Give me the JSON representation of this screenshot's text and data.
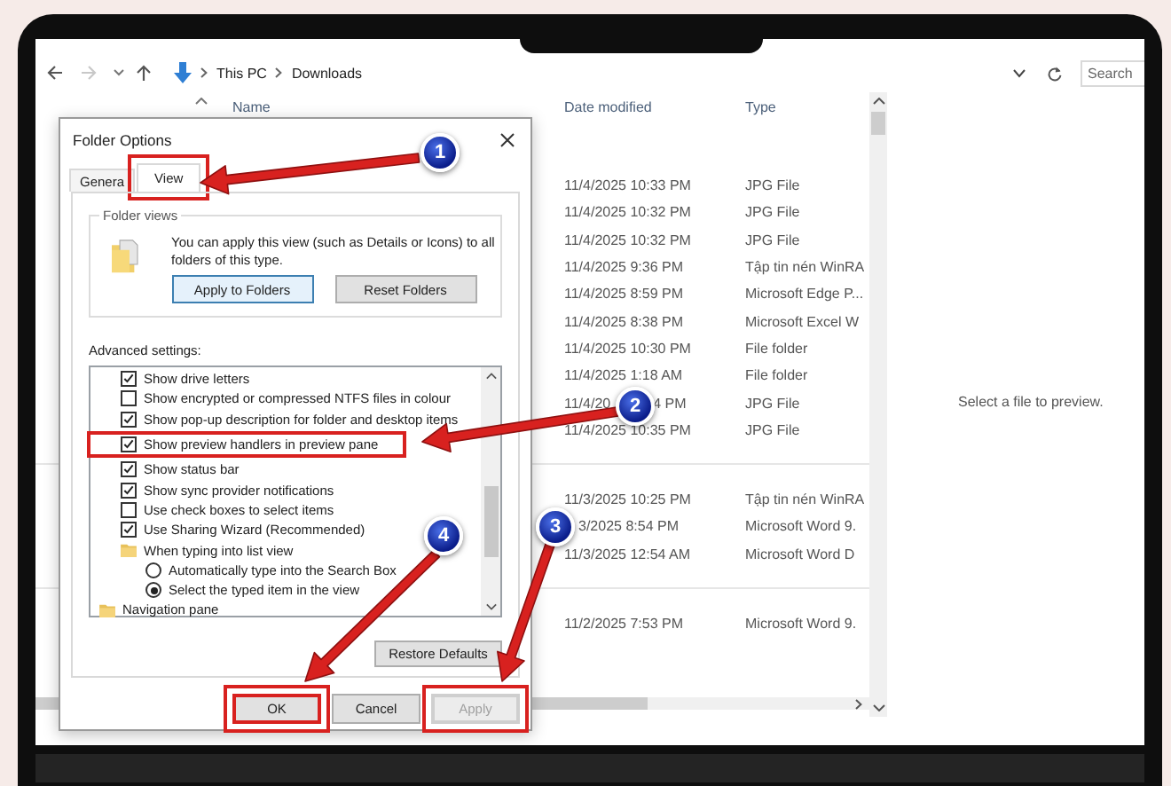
{
  "explorer": {
    "path": [
      "This PC",
      "Downloads"
    ],
    "search": {
      "placeholder": "Search"
    },
    "columns": [
      "Name",
      "Date modified",
      "Type"
    ],
    "groups": [
      {
        "rows": [
          {
            "date": "11/4/2025 10:33 PM",
            "type": "JPG File"
          },
          {
            "date": "11/4/2025 10:32 PM",
            "type": "JPG File"
          },
          {
            "date": "11/4/2025 10:32 PM",
            "type": "JPG File"
          },
          {
            "date": "11/4/2025 9:36 PM",
            "type": "Tập tin nén WinRA"
          },
          {
            "date": "11/4/2025 8:59 PM",
            "type": "Microsoft Edge P..."
          },
          {
            "date": "11/4/2025 8:38 PM",
            "type": "Microsoft Excel W"
          },
          {
            "date": "11/4/2025 10:30 PM",
            "type": "File folder"
          },
          {
            "date": "11/4/2025 1:18 AM",
            "type": "File folder"
          },
          {
            "date": "11/4/20",
            "date_end": "4 PM",
            "type": "JPG File"
          },
          {
            "date": "11/4/2025 10:35 PM",
            "type": "JPG File"
          }
        ]
      },
      {
        "rows": [
          {
            "date": "11/3/2025 10:25 PM",
            "type": "Tập tin nén WinRA"
          },
          {
            "date_end": "3/2025 8:54 PM",
            "type": "Microsoft Word 9."
          },
          {
            "date": "11/3/2025 12:54 AM",
            "type": "Microsoft Word D"
          }
        ]
      },
      {
        "rows": [
          {
            "date": "11/2/2025 7:53 PM",
            "type": "Microsoft Word 9."
          }
        ]
      }
    ],
    "preview_message": "Select a file to preview."
  },
  "dialog": {
    "title": "Folder Options",
    "tabs": [
      {
        "label": "Genera",
        "selected": false,
        "highlighted": false
      },
      {
        "label": "View",
        "selected": true,
        "highlighted": true
      }
    ],
    "folder_views": {
      "title": "Folder views",
      "text": "You can apply this view (such as Details or Icons) to all folders of this type.",
      "buttons": [
        {
          "label": "Apply to Folders",
          "focused": true
        },
        {
          "label": "Reset Folders",
          "focused": false
        }
      ]
    },
    "advanced_label": "Advanced settings:",
    "settings": [
      {
        "kind": "checkbox",
        "label": "Show drive letters",
        "checked": true,
        "highlighted": false
      },
      {
        "kind": "checkbox",
        "label": "Show encrypted or compressed NTFS files in colour",
        "checked": false,
        "highlighted": false
      },
      {
        "kind": "checkbox",
        "label": "Show pop-up description for folder and desktop items",
        "checked": true,
        "highlighted": false
      },
      {
        "kind": "checkbox",
        "label": "Show preview handlers in preview pane",
        "checked": true,
        "highlighted": true
      },
      {
        "kind": "checkbox",
        "label": "Show status bar",
        "checked": true,
        "highlighted": false
      },
      {
        "kind": "checkbox",
        "label": "Show sync provider notifications",
        "checked": true,
        "highlighted": false
      },
      {
        "kind": "checkbox",
        "label": "Use check boxes to select items",
        "checked": false,
        "highlighted": false
      },
      {
        "kind": "checkbox",
        "label": "Use Sharing Wizard (Recommended)",
        "checked": true,
        "highlighted": false
      },
      {
        "kind": "folder",
        "label": "When typing into list view",
        "children": [
          {
            "kind": "radio",
            "label": "Automatically type into the Search Box",
            "selected": false
          },
          {
            "kind": "radio",
            "label": "Select the typed item in the view",
            "selected": true
          }
        ]
      },
      {
        "kind": "category",
        "label": "Navigation pane"
      }
    ],
    "restore_button": "Restore Defaults",
    "buttons": [
      {
        "label": "OK",
        "disabled": false,
        "highlighted": true
      },
      {
        "label": "Cancel",
        "disabled": false,
        "highlighted": false
      },
      {
        "label": "Apply",
        "disabled": true,
        "highlighted": true
      }
    ]
  },
  "annotations": [
    {
      "number": "1"
    },
    {
      "number": "2"
    },
    {
      "number": "3"
    },
    {
      "number": "4"
    }
  ]
}
